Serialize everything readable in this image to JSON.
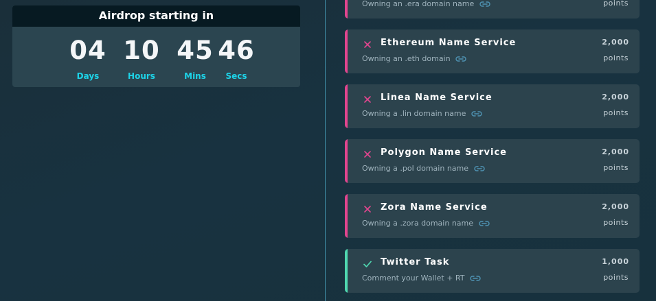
{
  "countdown": {
    "title": "Airdrop starting in",
    "days": "04",
    "days_label": "Days",
    "hours": "10",
    "hours_label": "Hours",
    "mins": "45",
    "mins_label": "Mins",
    "secs": "46",
    "secs_label": "Secs"
  },
  "colors": {
    "failed_accent": "#e2458f",
    "done_accent": "#4fd8b0",
    "label_accent": "#1dd3e8"
  },
  "tasks": [
    {
      "status": "failed",
      "status_icon": "close-icon",
      "title": "",
      "description": "Owning an .era domain name",
      "points": "",
      "points_label": "points"
    },
    {
      "status": "failed",
      "status_icon": "close-icon",
      "title": "Ethereum Name Service",
      "description": "Owning an .eth domain",
      "points": "2,000",
      "points_label": "points"
    },
    {
      "status": "failed",
      "status_icon": "close-icon",
      "title": "Linea Name Service",
      "description": "Owning a .lin domain name",
      "points": "2,000",
      "points_label": "points"
    },
    {
      "status": "failed",
      "status_icon": "close-icon",
      "title": "Polygon Name Service",
      "description": "Owning a .pol domain name",
      "points": "2,000",
      "points_label": "points"
    },
    {
      "status": "failed",
      "status_icon": "close-icon",
      "title": "Zora Name Service",
      "description": "Owning a .zora domain name",
      "points": "2,000",
      "points_label": "points"
    },
    {
      "status": "done",
      "status_icon": "check-icon",
      "title": "Twitter Task",
      "description": "Comment your Wallet + RT",
      "points": "1,000",
      "points_label": "points"
    }
  ]
}
